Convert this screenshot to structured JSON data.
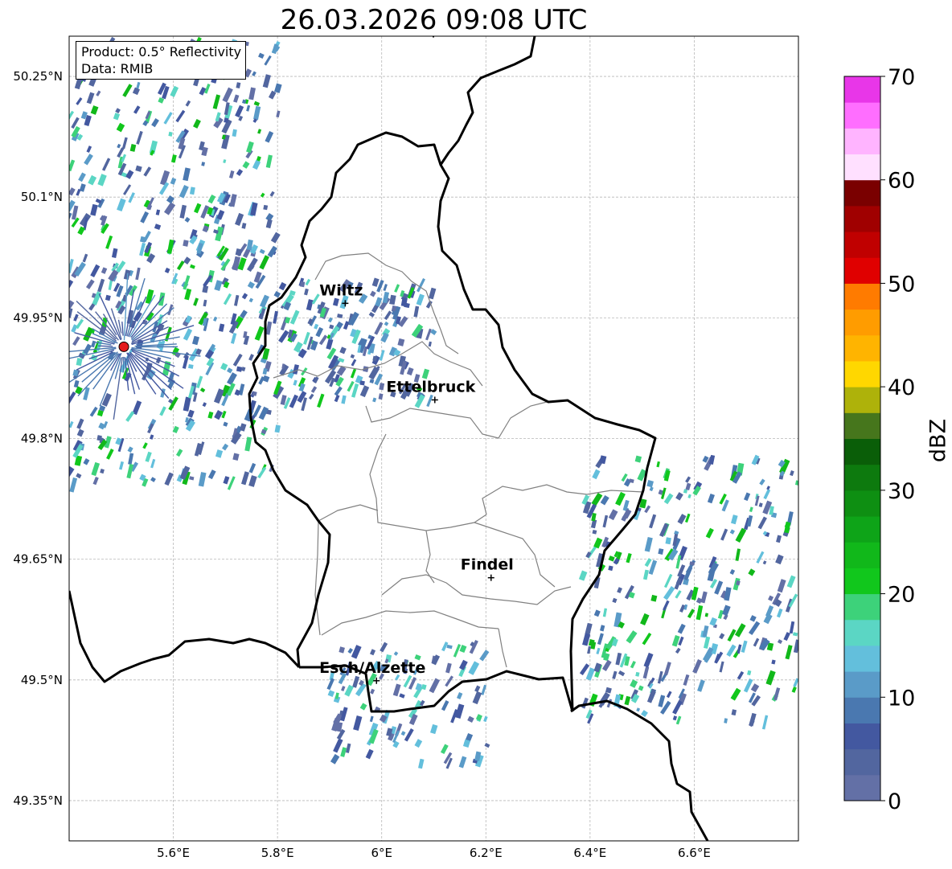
{
  "map": {
    "title": "26.03.2026 09:08 UTC",
    "info": {
      "product": "Product: 0.5° Reflectivity",
      "data": "Data: RMIB"
    },
    "lon_range": [
      5.4,
      6.8
    ],
    "lat_range": [
      49.3,
      50.3
    ],
    "gridlines": true,
    "x_ticks": [
      {
        "value": 5.6,
        "label": "5.6°E"
      },
      {
        "value": 5.8,
        "label": "5.8°E"
      },
      {
        "value": 6.0,
        "label": "6°E"
      },
      {
        "value": 6.2,
        "label": "6.2°E"
      },
      {
        "value": 6.4,
        "label": "6.4°E"
      },
      {
        "value": 6.6,
        "label": "6.6°E"
      }
    ],
    "y_ticks": [
      {
        "value": 50.25,
        "label": "50.25°N"
      },
      {
        "value": 50.1,
        "label": "50.1°N"
      },
      {
        "value": 49.95,
        "label": "49.95°N"
      },
      {
        "value": 49.8,
        "label": "49.8°N"
      },
      {
        "value": 49.65,
        "label": "49.65°N"
      },
      {
        "value": 49.5,
        "label": "49.5°N"
      },
      {
        "value": 49.35,
        "label": "49.35°N"
      }
    ],
    "cities": [
      {
        "name": "Wiltz",
        "lon": 5.93,
        "lat": 49.968
      },
      {
        "name": "Ettelbruck",
        "lon": 6.102,
        "lat": 49.848
      },
      {
        "name": "Findel",
        "lon": 6.21,
        "lat": 49.627
      },
      {
        "name": "Esch/Alzette",
        "lon": 5.99,
        "lat": 49.499
      }
    ],
    "radar_site": {
      "lon": 5.505,
      "lat": 49.914,
      "color": "#e41a1c"
    }
  },
  "colorbar": {
    "label": "dBZ",
    "min": 0,
    "max": 70,
    "step": 2.5,
    "ticks": [
      0,
      10,
      20,
      30,
      40,
      50,
      60,
      70
    ],
    "colors": [
      "#6370a6",
      "#52669f",
      "#4358a0",
      "#4a78b0",
      "#5a9bc8",
      "#63bfdc",
      "#5bd6c4",
      "#3dd27a",
      "#11c71c",
      "#11b81a",
      "#0ea418",
      "#0e8f12",
      "#0d7a0e",
      "#0a5e08",
      "#46761c",
      "#aeb20a",
      "#ffd700",
      "#ffb400",
      "#ff9c00",
      "#ff7b00",
      "#e00000",
      "#c00000",
      "#a00000",
      "#7a0000",
      "#ffe0ff",
      "#ffb4ff",
      "#ff6eff",
      "#e836e8"
    ]
  },
  "chart_data": {
    "type": "heatmap",
    "title": "26.03.2026 09:08 UTC",
    "variable": "0.5° Reflectivity",
    "units": "dBZ",
    "value_range": [
      0,
      70
    ],
    "extent": {
      "lon": [
        5.4,
        6.8
      ],
      "lat": [
        49.3,
        50.3
      ]
    },
    "echo_regions": [
      {
        "lon": [
          5.4,
          5.8
        ],
        "lat": [
          49.75,
          50.3
        ],
        "dbz_range": [
          2,
          25
        ]
      },
      {
        "lon": [
          5.8,
          6.1
        ],
        "lat": [
          49.85,
          50.0
        ],
        "dbz_range": [
          2,
          22
        ]
      },
      {
        "lon": [
          6.38,
          6.8
        ],
        "lat": [
          49.45,
          49.78
        ],
        "dbz_range": [
          2,
          25
        ]
      },
      {
        "lon": [
          5.9,
          6.2
        ],
        "lat": [
          49.4,
          49.55
        ],
        "dbz_range": [
          2,
          20
        ]
      }
    ]
  }
}
